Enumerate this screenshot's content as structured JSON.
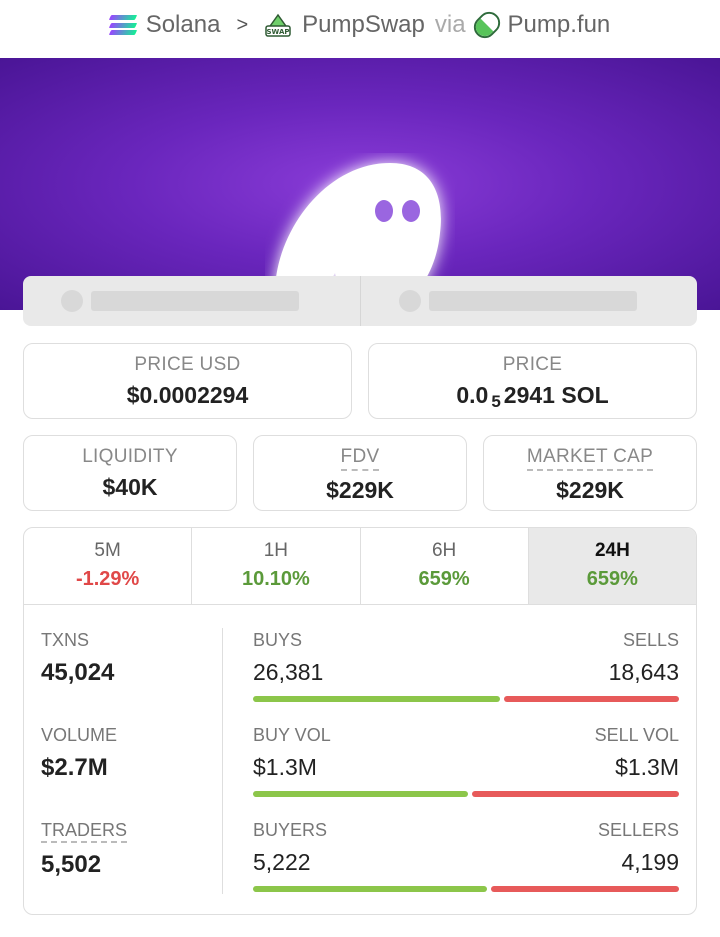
{
  "breadcrumb": {
    "chain": "Solana",
    "dex": "PumpSwap",
    "via": "via",
    "launchpad": "Pump.fun"
  },
  "socials": {
    "accent": "#e9e9e9"
  },
  "price": {
    "usd_label": "PRICE USD",
    "usd_value": "$0.0002294",
    "native_label": "PRICE",
    "native_prefix": "0.0",
    "native_zeros": "5",
    "native_suffix": "2941 SOL"
  },
  "metrics": {
    "liquidity_label": "LIQUIDITY",
    "liquidity_value": "$40K",
    "fdv_label": "FDV",
    "fdv_value": "$229K",
    "mcap_label": "MARKET CAP",
    "mcap_value": "$229K"
  },
  "tabs": [
    {
      "label": "5M",
      "value": "-1.29%",
      "trend": "down"
    },
    {
      "label": "1H",
      "value": "10.10%",
      "trend": "up"
    },
    {
      "label": "6H",
      "value": "659%",
      "trend": "up"
    },
    {
      "label": "24H",
      "value": "659%",
      "trend": "up",
      "active": true
    }
  ],
  "stats": {
    "txns_label": "TXNS",
    "txns_value": "45,024",
    "volume_label": "VOLUME",
    "volume_value": "$2.7M",
    "traders_label": "TRADERS",
    "traders_value": "5,502",
    "buys_label": "BUYS",
    "buys_value": "26,381",
    "sells_label": "SELLS",
    "sells_value": "18,643",
    "buys_share": 0.586,
    "buyvol_label": "BUY VOL",
    "buyvol_value": "$1.3M",
    "sellvol_label": "SELL VOL",
    "sellvol_value": "$1.3M",
    "buyvol_share": 0.51,
    "buyers_label": "BUYERS",
    "buyers_value": "5,222",
    "sellers_label": "SELLERS",
    "sellers_value": "4,199",
    "buyers_share": 0.554
  },
  "colors": {
    "positive": "#5b9a3a",
    "negative": "#e04848",
    "buy_bar": "#8cc64a",
    "sell_bar": "#e75a5a",
    "banner": "#6a26bd"
  }
}
